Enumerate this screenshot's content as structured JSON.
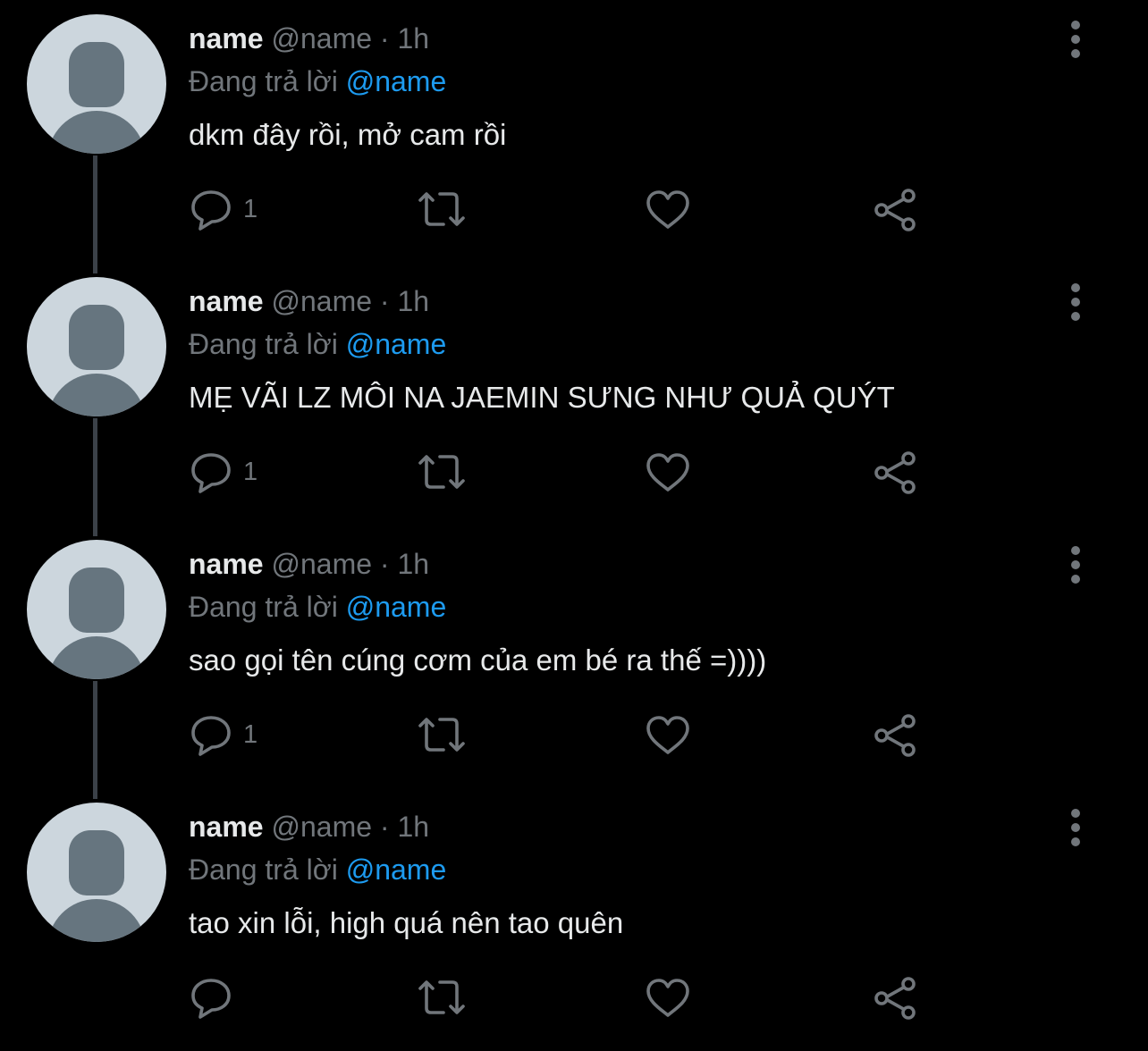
{
  "colors": {
    "background": "#000000",
    "primary_text": "#e7e9ea",
    "secondary_text": "#71767b",
    "mention": "#1d9bf0",
    "thread_line": "#3b4148",
    "avatar_bg": "#ccd6dd",
    "avatar_figure": "#66757f"
  },
  "icons": {
    "reply": "speech-bubble-icon",
    "retweet": "retweet-arrows-icon",
    "like": "heart-outline-icon",
    "share": "share-nodes-icon",
    "more": "vertical-ellipsis-icon"
  },
  "tweets": [
    {
      "display_name": "name",
      "handle": "@name",
      "separator": "·",
      "time": "1h",
      "reply_prefix": "Đang trả lời",
      "reply_to": "@name",
      "text": "dkm đây rồi, mở cam rồi",
      "reply_count": "1"
    },
    {
      "display_name": "name",
      "handle": "@name",
      "separator": "·",
      "time": "1h",
      "reply_prefix": "Đang trả lời",
      "reply_to": "@name",
      "text": "MẸ VÃI LZ MÔI NA JAEMIN SƯNG NHƯ QUẢ QUÝT",
      "reply_count": "1"
    },
    {
      "display_name": "name",
      "handle": "@name",
      "separator": "·",
      "time": "1h",
      "reply_prefix": "Đang trả lời",
      "reply_to": "@name",
      "text": "sao gọi tên cúng cơm của em bé ra thế =))))",
      "reply_count": "1"
    },
    {
      "display_name": "name",
      "handle": "@name",
      "separator": "·",
      "time": "1h",
      "reply_prefix": "Đang trả lời",
      "reply_to": "@name",
      "text": "tao xin lỗi, high quá nên tao quên",
      "reply_count": ""
    }
  ]
}
